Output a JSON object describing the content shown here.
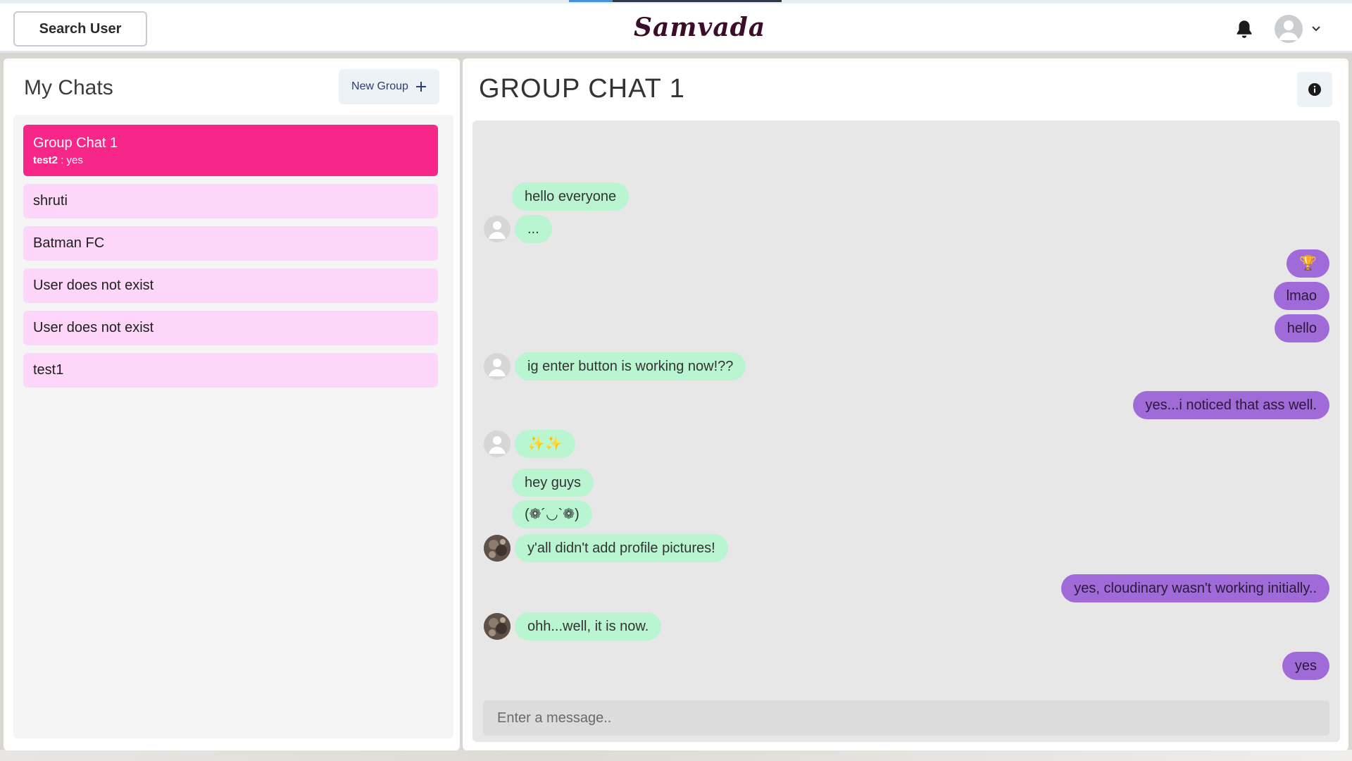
{
  "header": {
    "search_label": "Search User",
    "logo_text": "Samvada",
    "icons": {
      "notifications": "bell-icon",
      "profile": "user-avatar-icon",
      "menu": "chevron-down-icon"
    }
  },
  "sidebar": {
    "title": "My Chats",
    "new_group_label": "New Group",
    "new_group_icon": "plus-icon",
    "chats": [
      {
        "name": "Group Chat 1",
        "latest_sender": "test2",
        "latest_text": "yes",
        "active": true
      },
      {
        "name": "shruti"
      },
      {
        "name": "Batman FC"
      },
      {
        "name": "User does not exist"
      },
      {
        "name": "User does not exist"
      },
      {
        "name": "test1"
      }
    ]
  },
  "chat": {
    "title": "GROUP CHAT 1",
    "info_icon": "info-icon",
    "messages": [
      {
        "text": "hello everyone",
        "direction": "in"
      },
      {
        "text": "...",
        "direction": "in",
        "avatar": "default"
      },
      {
        "text": "🏆",
        "direction": "out"
      },
      {
        "text": "lmao",
        "direction": "out"
      },
      {
        "text": "hello",
        "direction": "out"
      },
      {
        "text": "ig enter button is working now!??",
        "direction": "in",
        "avatar": "default"
      },
      {
        "text": "yes...i noticed that ass well.",
        "direction": "out"
      },
      {
        "text": "✨✨",
        "direction": "in",
        "avatar": "default"
      },
      {
        "text": "hey guys",
        "direction": "in"
      },
      {
        "text": "(❁´◡`❁)",
        "direction": "in"
      },
      {
        "text": "y'all didn't add profile pictures!",
        "direction": "in",
        "avatar": "photo"
      },
      {
        "text": "yes, cloudinary wasn't working initially..",
        "direction": "out"
      },
      {
        "text": "ohh...well, it is now.",
        "direction": "in",
        "avatar": "photo"
      },
      {
        "text": "yes",
        "direction": "out"
      }
    ],
    "input_placeholder": "Enter a message.."
  },
  "colors": {
    "active_chat": "#f72689",
    "chat_item": "#fdd6f9",
    "incoming_bubble": "#b9f5d0",
    "outgoing_bubble": "#a06ad9"
  }
}
